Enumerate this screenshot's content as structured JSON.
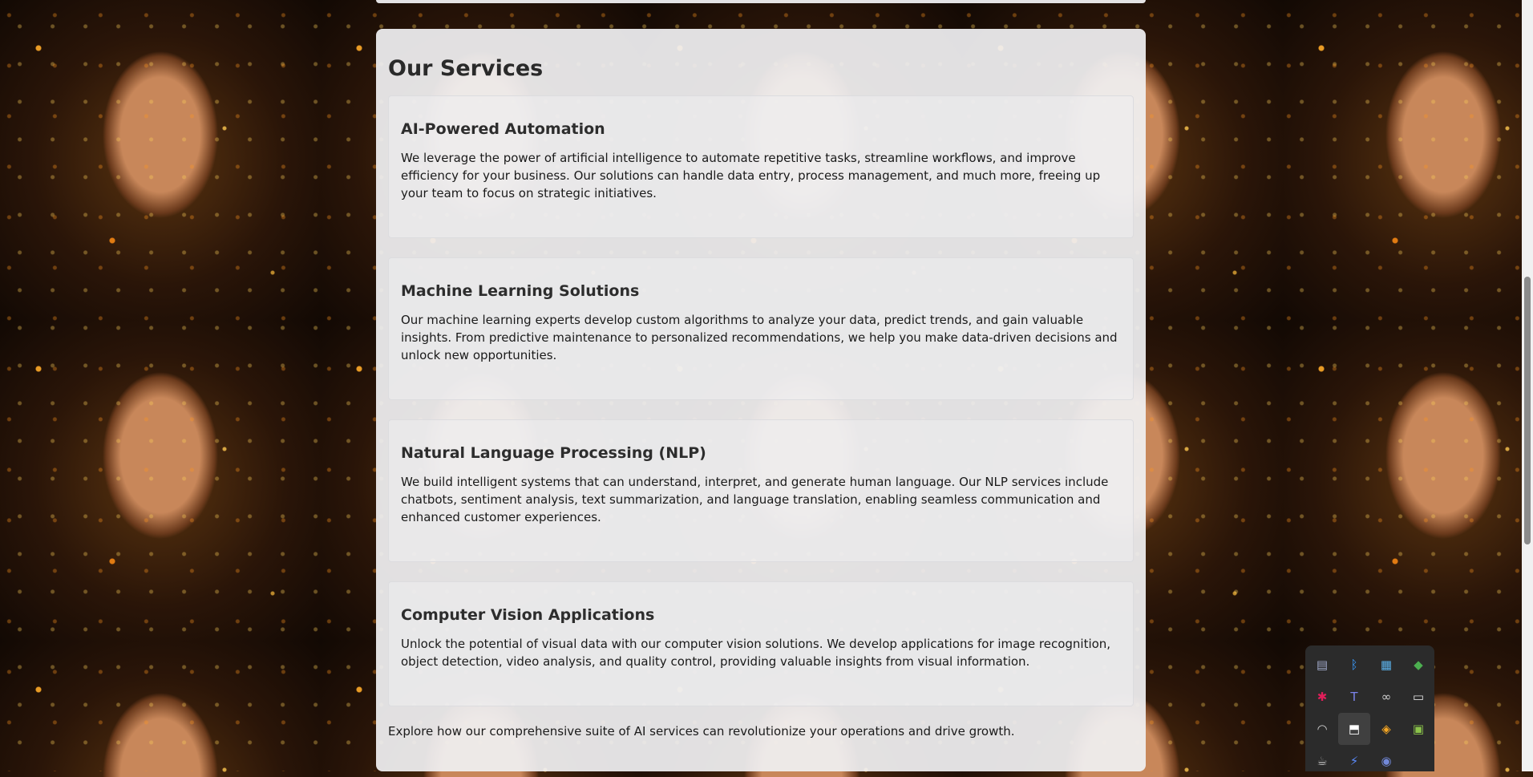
{
  "services": {
    "title": "Our Services",
    "items": [
      {
        "heading": "AI-Powered Automation",
        "description": "We leverage the power of artificial intelligence to automate repetitive tasks, streamline workflows, and improve efficiency for your business. Our solutions can handle data entry, process management, and much more, freeing up your team to focus on strategic initiatives."
      },
      {
        "heading": "Machine Learning Solutions",
        "description": "Our machine learning experts develop custom algorithms to analyze your data, predict trends, and gain valuable insights. From predictive maintenance to personalized recommendations, we help you make data-driven decisions and unlock new opportunities."
      },
      {
        "heading": "Natural Language Processing (NLP)",
        "description": "We build intelligent systems that can understand, interpret, and generate human language. Our NLP services include chatbots, sentiment analysis, text summarization, and language translation, enabling seamless communication and enhanced customer experiences."
      },
      {
        "heading": "Computer Vision Applications",
        "description": "Unlock the potential of visual data with our computer vision solutions. We develop applications for image recognition, object detection, video analysis, and quality control, providing valuable insights from visual information."
      }
    ],
    "closing": "Explore how our comprehensive suite of AI services can revolutionize your operations and drive growth."
  },
  "tray": {
    "icons": [
      {
        "name": "chat-app-icon",
        "glyph": "▤",
        "color": "#a0a8c8"
      },
      {
        "name": "bluetooth-icon",
        "glyph": "ᛒ",
        "color": "#3b9cff"
      },
      {
        "name": "network-monitor-icon",
        "glyph": "▦",
        "color": "#5ab0e8"
      },
      {
        "name": "security-shield-icon",
        "glyph": "◆",
        "color": "#4caf50"
      },
      {
        "name": "slack-icon",
        "glyph": "✱",
        "color": "#e01e5a"
      },
      {
        "name": "teams-icon",
        "glyph": "T",
        "color": "#7b83eb"
      },
      {
        "name": "link-tool-icon",
        "glyph": "∞",
        "color": "#d0d0d0"
      },
      {
        "name": "battery-icon",
        "glyph": "▭",
        "color": "#e0e0e0"
      },
      {
        "name": "wifi-icon",
        "glyph": "◠",
        "color": "#d0d0d0"
      },
      {
        "name": "bookmark-icon",
        "glyph": "⬒",
        "color": "#ffffff"
      },
      {
        "name": "layers-icon",
        "glyph": "◈",
        "color": "#f5a623"
      },
      {
        "name": "color-picker-icon",
        "glyph": "▣",
        "color": "#8bc34a"
      },
      {
        "name": "coffee-icon",
        "glyph": "☕",
        "color": "#c0c0c0"
      },
      {
        "name": "power-toys-icon",
        "glyph": "⚡",
        "color": "#5b8cff"
      },
      {
        "name": "discord-icon",
        "glyph": "◉",
        "color": "#7289da"
      }
    ]
  }
}
